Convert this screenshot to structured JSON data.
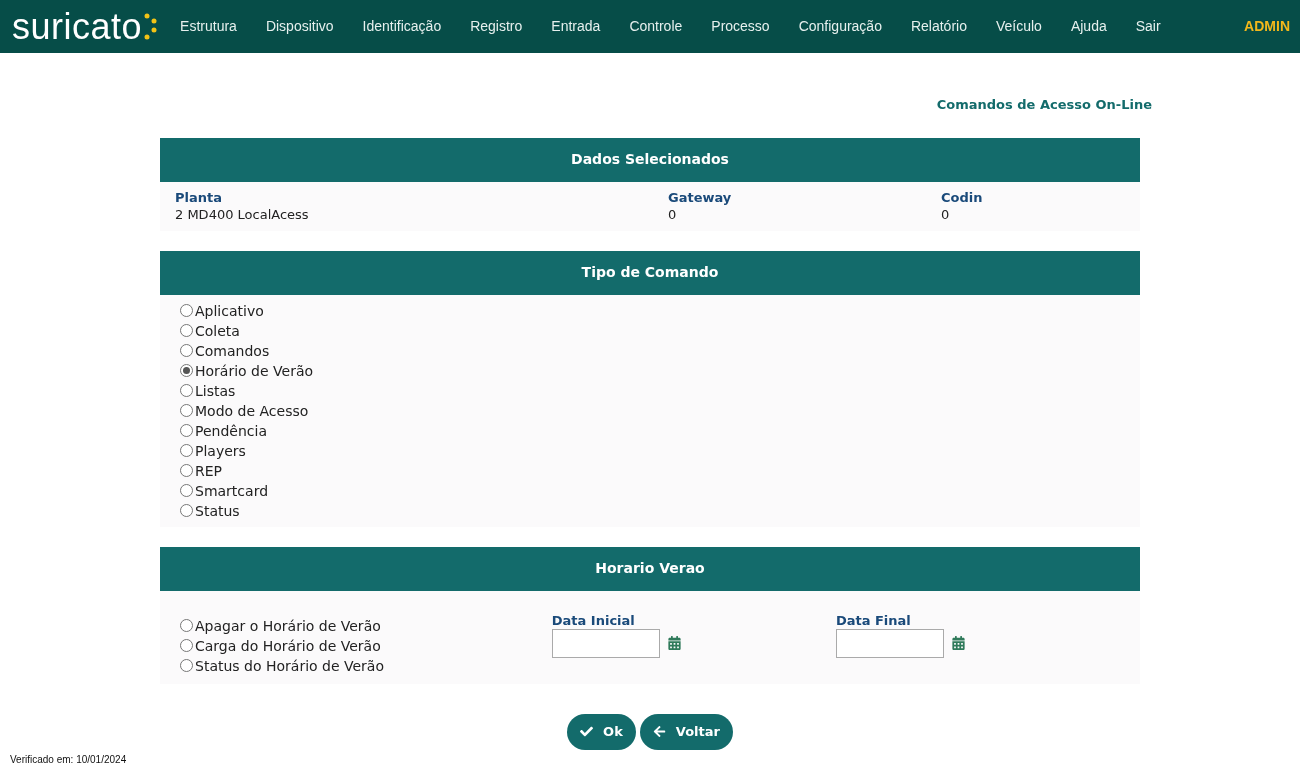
{
  "header": {
    "logo": "suricato",
    "nav": [
      "Estrutura",
      "Dispositivo",
      "Identificação",
      "Registro",
      "Entrada",
      "Controle",
      "Processo",
      "Configuração",
      "Relatório",
      "Veículo",
      "Ajuda",
      "Sair"
    ],
    "user": "ADMIN"
  },
  "page_title": "Comandos de Acesso On-Line",
  "selected_data": {
    "title": "Dados Selecionados",
    "fields": [
      {
        "label": "Planta",
        "value": "2 MD400 LocalAcess"
      },
      {
        "label": "Gateway",
        "value": "0"
      },
      {
        "label": "Codin",
        "value": "0"
      }
    ]
  },
  "command_type": {
    "title": "Tipo de Comando",
    "options": [
      {
        "label": "Aplicativo",
        "selected": false
      },
      {
        "label": "Coleta",
        "selected": false
      },
      {
        "label": "Comandos",
        "selected": false
      },
      {
        "label": "Horário de Verão",
        "selected": true
      },
      {
        "label": "Listas",
        "selected": false
      },
      {
        "label": "Modo de Acesso",
        "selected": false
      },
      {
        "label": "Pendência",
        "selected": false
      },
      {
        "label": "Players",
        "selected": false
      },
      {
        "label": "REP",
        "selected": false
      },
      {
        "label": "Smartcard",
        "selected": false
      },
      {
        "label": "Status",
        "selected": false
      }
    ]
  },
  "dst": {
    "title": "Horario Verao",
    "options": [
      {
        "label": "Apagar o Horário de Verão",
        "selected": false
      },
      {
        "label": "Carga do Horário de Verão",
        "selected": false
      },
      {
        "label": "Status do Horário de Verão",
        "selected": false
      }
    ],
    "dates": [
      {
        "label": "Data Inicial"
      },
      {
        "label": "Data Final"
      }
    ]
  },
  "buttons": [
    {
      "label": "Ok",
      "kind": "check"
    },
    {
      "label": "Voltar",
      "kind": "back"
    }
  ],
  "footer": "Verificado em: 10/01/2024"
}
